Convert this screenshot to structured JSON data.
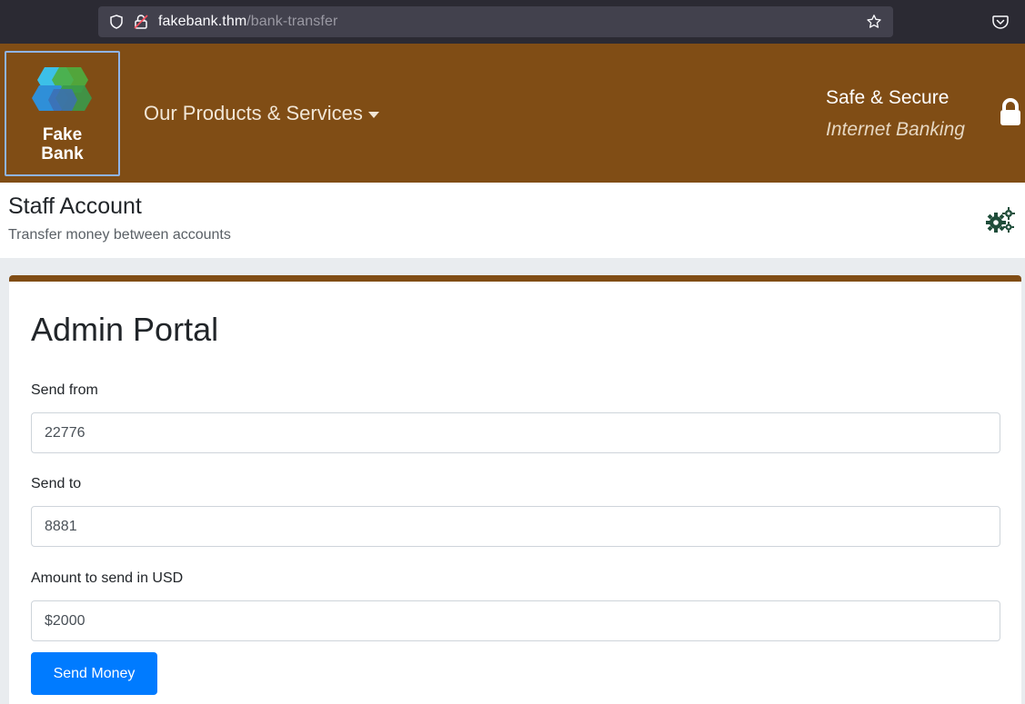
{
  "browser": {
    "url_host": "fakebank.thm",
    "url_path": "/bank-transfer"
  },
  "header": {
    "logo_line1": "Fake",
    "logo_line2": "Bank",
    "nav_products": "Our Products & Services",
    "secure_title": "Safe & Secure",
    "secure_sub": "Internet Banking"
  },
  "subheader": {
    "title": "Staff Account",
    "subtitle": "Transfer money between accounts"
  },
  "portal": {
    "title": "Admin Portal",
    "send_from_label": "Send from",
    "send_from_value": "22776",
    "send_to_label": "Send to",
    "send_to_value": "8881",
    "amount_label": "Amount to send in USD",
    "amount_value": "$2000",
    "submit_label": "Send Money"
  },
  "colors": {
    "brand": "#804d15",
    "primary_button": "#007bff",
    "gears": "#1f4d3a"
  },
  "icons": [
    "shield-icon",
    "lock-icon",
    "star-icon",
    "pocket-icon",
    "fake-bank-logo",
    "padlock-icon",
    "gears-icon",
    "caret-down-icon"
  ]
}
